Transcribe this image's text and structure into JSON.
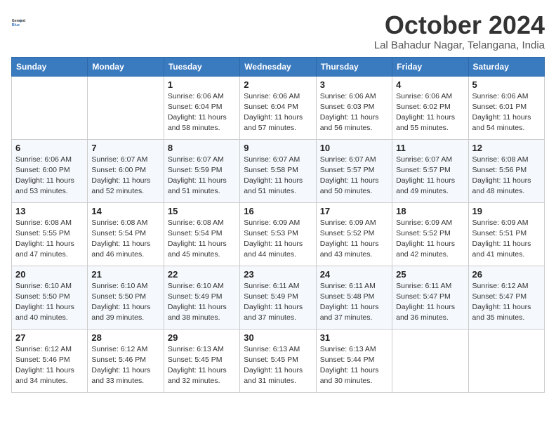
{
  "header": {
    "logo_line1": "General",
    "logo_line2": "Blue",
    "month": "October 2024",
    "location": "Lal Bahadur Nagar, Telangana, India"
  },
  "days_of_week": [
    "Sunday",
    "Monday",
    "Tuesday",
    "Wednesday",
    "Thursday",
    "Friday",
    "Saturday"
  ],
  "weeks": [
    [
      {
        "day": "",
        "info": ""
      },
      {
        "day": "",
        "info": ""
      },
      {
        "day": "1",
        "info": "Sunrise: 6:06 AM\nSunset: 6:04 PM\nDaylight: 11 hours and 58 minutes."
      },
      {
        "day": "2",
        "info": "Sunrise: 6:06 AM\nSunset: 6:04 PM\nDaylight: 11 hours and 57 minutes."
      },
      {
        "day": "3",
        "info": "Sunrise: 6:06 AM\nSunset: 6:03 PM\nDaylight: 11 hours and 56 minutes."
      },
      {
        "day": "4",
        "info": "Sunrise: 6:06 AM\nSunset: 6:02 PM\nDaylight: 11 hours and 55 minutes."
      },
      {
        "day": "5",
        "info": "Sunrise: 6:06 AM\nSunset: 6:01 PM\nDaylight: 11 hours and 54 minutes."
      }
    ],
    [
      {
        "day": "6",
        "info": "Sunrise: 6:06 AM\nSunset: 6:00 PM\nDaylight: 11 hours and 53 minutes."
      },
      {
        "day": "7",
        "info": "Sunrise: 6:07 AM\nSunset: 6:00 PM\nDaylight: 11 hours and 52 minutes."
      },
      {
        "day": "8",
        "info": "Sunrise: 6:07 AM\nSunset: 5:59 PM\nDaylight: 11 hours and 51 minutes."
      },
      {
        "day": "9",
        "info": "Sunrise: 6:07 AM\nSunset: 5:58 PM\nDaylight: 11 hours and 51 minutes."
      },
      {
        "day": "10",
        "info": "Sunrise: 6:07 AM\nSunset: 5:57 PM\nDaylight: 11 hours and 50 minutes."
      },
      {
        "day": "11",
        "info": "Sunrise: 6:07 AM\nSunset: 5:57 PM\nDaylight: 11 hours and 49 minutes."
      },
      {
        "day": "12",
        "info": "Sunrise: 6:08 AM\nSunset: 5:56 PM\nDaylight: 11 hours and 48 minutes."
      }
    ],
    [
      {
        "day": "13",
        "info": "Sunrise: 6:08 AM\nSunset: 5:55 PM\nDaylight: 11 hours and 47 minutes."
      },
      {
        "day": "14",
        "info": "Sunrise: 6:08 AM\nSunset: 5:54 PM\nDaylight: 11 hours and 46 minutes."
      },
      {
        "day": "15",
        "info": "Sunrise: 6:08 AM\nSunset: 5:54 PM\nDaylight: 11 hours and 45 minutes."
      },
      {
        "day": "16",
        "info": "Sunrise: 6:09 AM\nSunset: 5:53 PM\nDaylight: 11 hours and 44 minutes."
      },
      {
        "day": "17",
        "info": "Sunrise: 6:09 AM\nSunset: 5:52 PM\nDaylight: 11 hours and 43 minutes."
      },
      {
        "day": "18",
        "info": "Sunrise: 6:09 AM\nSunset: 5:52 PM\nDaylight: 11 hours and 42 minutes."
      },
      {
        "day": "19",
        "info": "Sunrise: 6:09 AM\nSunset: 5:51 PM\nDaylight: 11 hours and 41 minutes."
      }
    ],
    [
      {
        "day": "20",
        "info": "Sunrise: 6:10 AM\nSunset: 5:50 PM\nDaylight: 11 hours and 40 minutes."
      },
      {
        "day": "21",
        "info": "Sunrise: 6:10 AM\nSunset: 5:50 PM\nDaylight: 11 hours and 39 minutes."
      },
      {
        "day": "22",
        "info": "Sunrise: 6:10 AM\nSunset: 5:49 PM\nDaylight: 11 hours and 38 minutes."
      },
      {
        "day": "23",
        "info": "Sunrise: 6:11 AM\nSunset: 5:49 PM\nDaylight: 11 hours and 37 minutes."
      },
      {
        "day": "24",
        "info": "Sunrise: 6:11 AM\nSunset: 5:48 PM\nDaylight: 11 hours and 37 minutes."
      },
      {
        "day": "25",
        "info": "Sunrise: 6:11 AM\nSunset: 5:47 PM\nDaylight: 11 hours and 36 minutes."
      },
      {
        "day": "26",
        "info": "Sunrise: 6:12 AM\nSunset: 5:47 PM\nDaylight: 11 hours and 35 minutes."
      }
    ],
    [
      {
        "day": "27",
        "info": "Sunrise: 6:12 AM\nSunset: 5:46 PM\nDaylight: 11 hours and 34 minutes."
      },
      {
        "day": "28",
        "info": "Sunrise: 6:12 AM\nSunset: 5:46 PM\nDaylight: 11 hours and 33 minutes."
      },
      {
        "day": "29",
        "info": "Sunrise: 6:13 AM\nSunset: 5:45 PM\nDaylight: 11 hours and 32 minutes."
      },
      {
        "day": "30",
        "info": "Sunrise: 6:13 AM\nSunset: 5:45 PM\nDaylight: 11 hours and 31 minutes."
      },
      {
        "day": "31",
        "info": "Sunrise: 6:13 AM\nSunset: 5:44 PM\nDaylight: 11 hours and 30 minutes."
      },
      {
        "day": "",
        "info": ""
      },
      {
        "day": "",
        "info": ""
      }
    ]
  ]
}
